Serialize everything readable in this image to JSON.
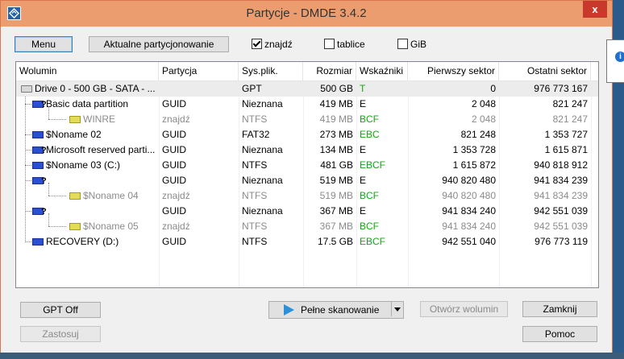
{
  "window": {
    "title": "Partycje - DMDE 3.4.2",
    "close": "x"
  },
  "toolbar": {
    "menu": "Menu",
    "current_partitioning": "Aktualne partycjonowanie",
    "found": "znajdź",
    "tables": "tablice",
    "gib": "GiB"
  },
  "columns": [
    "Wolumin",
    "Partycja",
    "Sys.plik.",
    "Rozmiar",
    "Wskaźniki",
    "Pierwszy sektor",
    "Ostatni sektor"
  ],
  "rows": [
    {
      "name": "Drive 0 - 500 GB - SATA - ...",
      "partition": "",
      "fs": "GPT",
      "size": "500 GB",
      "flags": "T",
      "first": "0",
      "last": "976 773 167",
      "icon": "drive",
      "style": "",
      "sel": true
    },
    {
      "name": "Basic data partition",
      "partition": "GUID",
      "fs": "Nieznana",
      "size": "419 MB",
      "flags": "E",
      "first": "2 048",
      "last": "821 247",
      "icon": "partq",
      "style": ""
    },
    {
      "name": "WINRE",
      "partition": "znajdź",
      "fs": "NTFS",
      "size": "419 MB",
      "flags": "BCF",
      "first": "2 048",
      "last": "821 247",
      "icon": "fs",
      "style": "gray"
    },
    {
      "name": "$Noname 02",
      "partition": "GUID",
      "fs": "FAT32",
      "size": "273 MB",
      "flags": "EBC",
      "first": "821 248",
      "last": "1 353 727",
      "icon": "part",
      "style": ""
    },
    {
      "name": "Microsoft reserved parti...",
      "partition": "GUID",
      "fs": "Nieznana",
      "size": "134 MB",
      "flags": "E",
      "first": "1 353 728",
      "last": "1 615 871",
      "icon": "partq",
      "style": ""
    },
    {
      "name": "$Noname 03 (C:)",
      "partition": "GUID",
      "fs": "NTFS",
      "size": "481 GB",
      "flags": "EBCF",
      "first": "1 615 872",
      "last": "940 818 912",
      "icon": "part",
      "style": ""
    },
    {
      "name": "",
      "partition": "GUID",
      "fs": "Nieznana",
      "size": "519 MB",
      "flags": "E",
      "first": "940 820 480",
      "last": "941 834 239",
      "icon": "partq",
      "style": ""
    },
    {
      "name": "$Noname 04",
      "partition": "znajdź",
      "fs": "NTFS",
      "size": "519 MB",
      "flags": "BCF",
      "first": "940 820 480",
      "last": "941 834 239",
      "icon": "fs",
      "style": "gray"
    },
    {
      "name": "",
      "partition": "GUID",
      "fs": "Nieznana",
      "size": "367 MB",
      "flags": "E",
      "first": "941 834 240",
      "last": "942 551 039",
      "icon": "partq",
      "style": ""
    },
    {
      "name": "$Noname 05",
      "partition": "znajdź",
      "fs": "NTFS",
      "size": "367 MB",
      "flags": "BCF",
      "first": "941 834 240",
      "last": "942 551 039",
      "icon": "fs",
      "style": "gray"
    },
    {
      "name": "RECOVERY (D:)",
      "partition": "GUID",
      "fs": "NTFS",
      "size": "17.5 GB",
      "flags": "EBCF",
      "first": "942 551 040",
      "last": "976 773 119",
      "icon": "part",
      "style": ""
    }
  ],
  "buttons": {
    "gpt_off": "GPT Off",
    "apply": "Zastosuj",
    "full_scan": "Pełne skanowanie",
    "open_volume": "Otwórz wolumin",
    "close": "Zamknij",
    "help": "Pomoc"
  },
  "info_icon": "i"
}
